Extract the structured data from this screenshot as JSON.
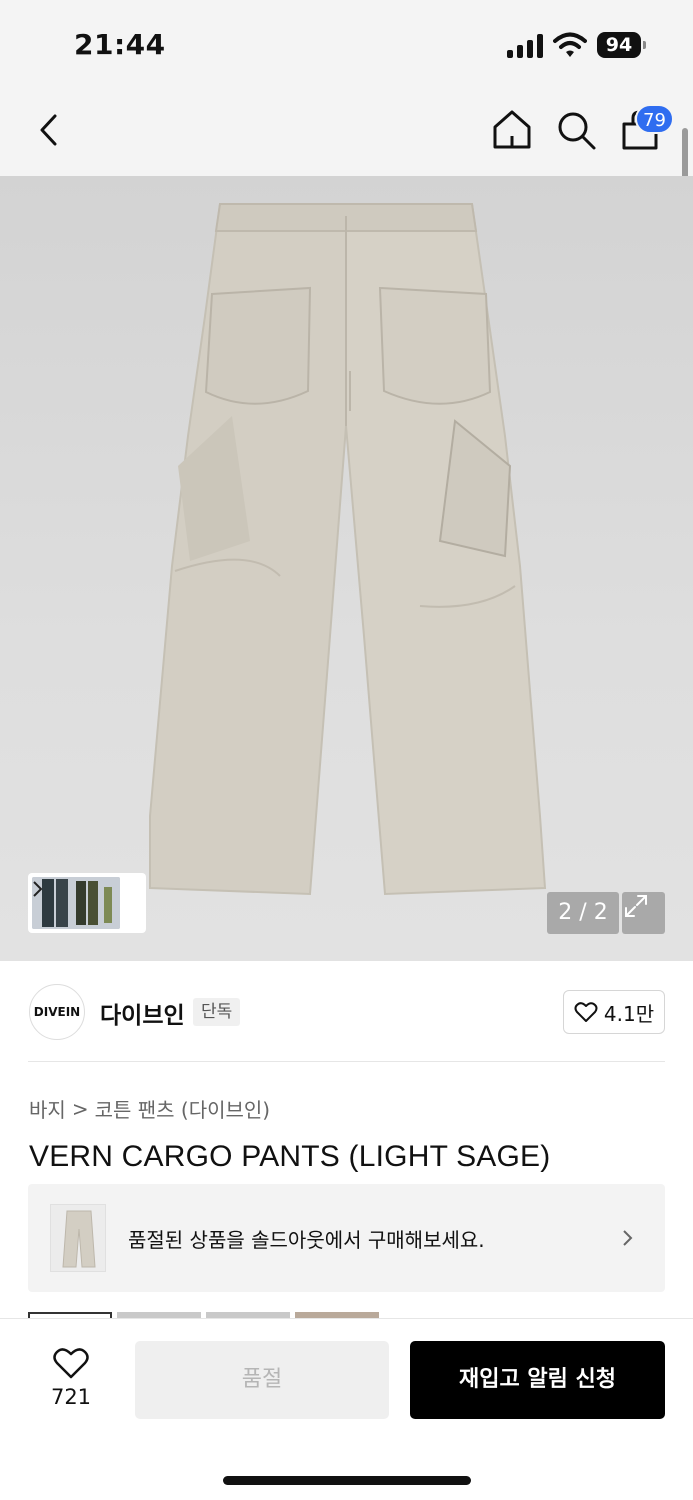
{
  "status_bar": {
    "time": "21:44",
    "battery": "94",
    "icons": [
      "signal-icon",
      "wifi-icon",
      "battery-icon"
    ]
  },
  "nav": {
    "icons": [
      "back-icon",
      "home-icon",
      "search-icon",
      "shopping-bag-icon"
    ],
    "bag_badge": "79"
  },
  "gallery": {
    "counter": "2 / 2",
    "colors": {
      "product": "#d3cec3",
      "background": "#dcdcdc"
    }
  },
  "brand": {
    "logo_text": "DIVEIN",
    "name": "다이브인",
    "tag": "단독",
    "like_count": "4.1만"
  },
  "breadcrumb": {
    "category": "바지",
    "separator": ">",
    "subcategory": "코튼 팬츠 (다이브인)"
  },
  "product": {
    "title": "VERN CARGO PANTS (LIGHT SAGE)"
  },
  "soldout_banner": {
    "text": "품절된 상품을 솔드아웃에서 구매해보세요."
  },
  "bottom_bar": {
    "wish_count": "721",
    "soldout_label": "품절",
    "restock_label": "재입고 알림 신청",
    "accent_color": "#000000"
  }
}
